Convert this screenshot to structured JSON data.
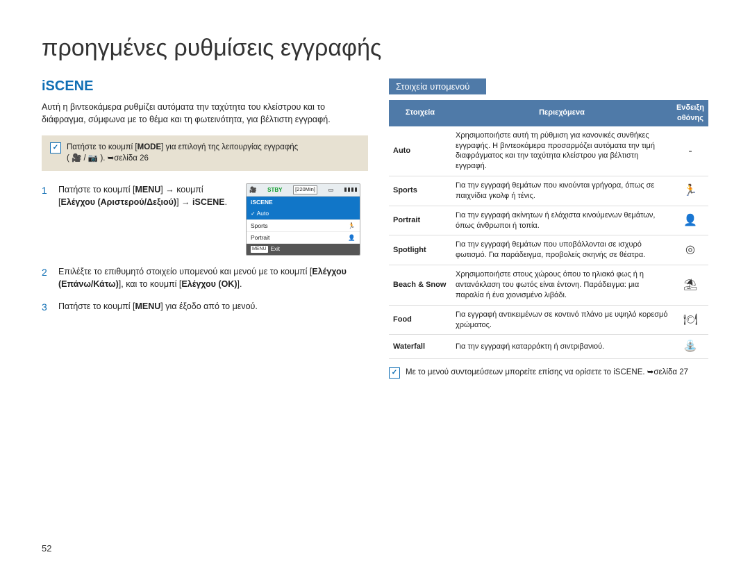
{
  "page_number": "52",
  "title": "προηγμένες ρυθμίσεις εγγραφής",
  "section_heading": "iSCENE",
  "intro": "Αυτή η βιντεοκάμερα ρυθμίζει αυτόματα την ταχύτητα του κλείστρου και το διάφραγμα, σύμφωνα με το θέμα και τη φωτεινότητα, για βέλτιστη εγγραφή.",
  "note_pre": "Πατήστε το κουμπί [",
  "note_mode": "MODE",
  "note_post": "] για επιλογή της λειτουργίας εγγραφής",
  "note_icons_line": "( 🎥 / 📷 ). ➥σελίδα 26",
  "step1": {
    "num": "1",
    "a": "Πατήστε το κουμπί [",
    "menu": "MENU",
    "b": "] → κουμπί [",
    "ctrl": "Ελέγχου (Αριστερού/Δεξιού)",
    "c": "] → ",
    "iscene": "iSCENE",
    "d": "."
  },
  "step2": {
    "num": "2",
    "a": "Επιλέξτε το επιθυμητό στοιχείο υπομενού και μενού με το κουμπί [",
    "ctrl": "Ελέγχου (Επάνω/Κάτω)",
    "b": "], και το κουμπί [",
    "ok": "Ελέγχου (OK)",
    "c": "]."
  },
  "step3": {
    "num": "3",
    "a": "Πατήστε το κουμπί [",
    "menu": "MENU",
    "b": "] για έξοδο από το μενού."
  },
  "lcd": {
    "stby": "STBY",
    "time": "[220Min]",
    "header": "iSCENE",
    "rows": {
      "auto": "Auto",
      "sports": "Sports",
      "portrait": "Portrait"
    },
    "check": "✓",
    "exit_tag": "MENU",
    "exit": "Exit"
  },
  "sub_heading": "Στοιχεία υπομενού",
  "table": {
    "col1": "Στοιχεία",
    "col2": "Περιεχόμενα",
    "col3a": "Ενδειξη",
    "col3b": "οθόνης",
    "rows": [
      {
        "name": "Auto",
        "desc": "Χρησιμοποιήστε αυτή τη ρύθμιση για κανονικές συνθήκες εγγραφής. Η βιντεοκάμερα προσαρμόζει αυτόματα την τιμή διαφράγματος και την ταχύτητα κλείστρου για βέλτιστη εγγραφή.",
        "icon": "-"
      },
      {
        "name": "Sports",
        "desc": "Για την εγγραφή θεμάτων που κινούνται γρήγορα, όπως σε παιχνίδια γκολφ ή τένις.",
        "icon": "🏃"
      },
      {
        "name": "Portrait",
        "desc": "Για την εγγραφή ακίνητων ή ελάχιστα κινούμενων θεμάτων, όπως άνθρωποι ή τοπία.",
        "icon": "👤"
      },
      {
        "name": "Spotlight",
        "desc": "Για την εγγραφή θεμάτων που υποβάλλονται σε ισχυρό φωτισμό. Για παράδειγμα, προβολείς σκηνής σε θέατρα.",
        "icon": "◎"
      },
      {
        "name": "Beach & Snow",
        "desc": "Χρησιμοποιήστε στους χώρους όπου το ηλιακό φως ή η αντανάκλαση του φωτός είναι έντονη. Παράδειγμα: μια παραλία ή ένα χιονισμένο λιβάδι.",
        "icon": "⛱"
      },
      {
        "name": "Food",
        "desc": "Για εγγραφή αντικειμένων σε κοντινό πλάνο με υψηλό κορεσμό χρώματος.",
        "icon": "🍽"
      },
      {
        "name": "Waterfall",
        "desc": "Για την εγγραφή καταρράκτη ή σιντριβανιού.",
        "icon": "⛲"
      }
    ]
  },
  "note2": "Με το μενού συντομεύσεων μπορείτε επίσης να ορίσετε το iSCENE. ➥σελίδα 27"
}
